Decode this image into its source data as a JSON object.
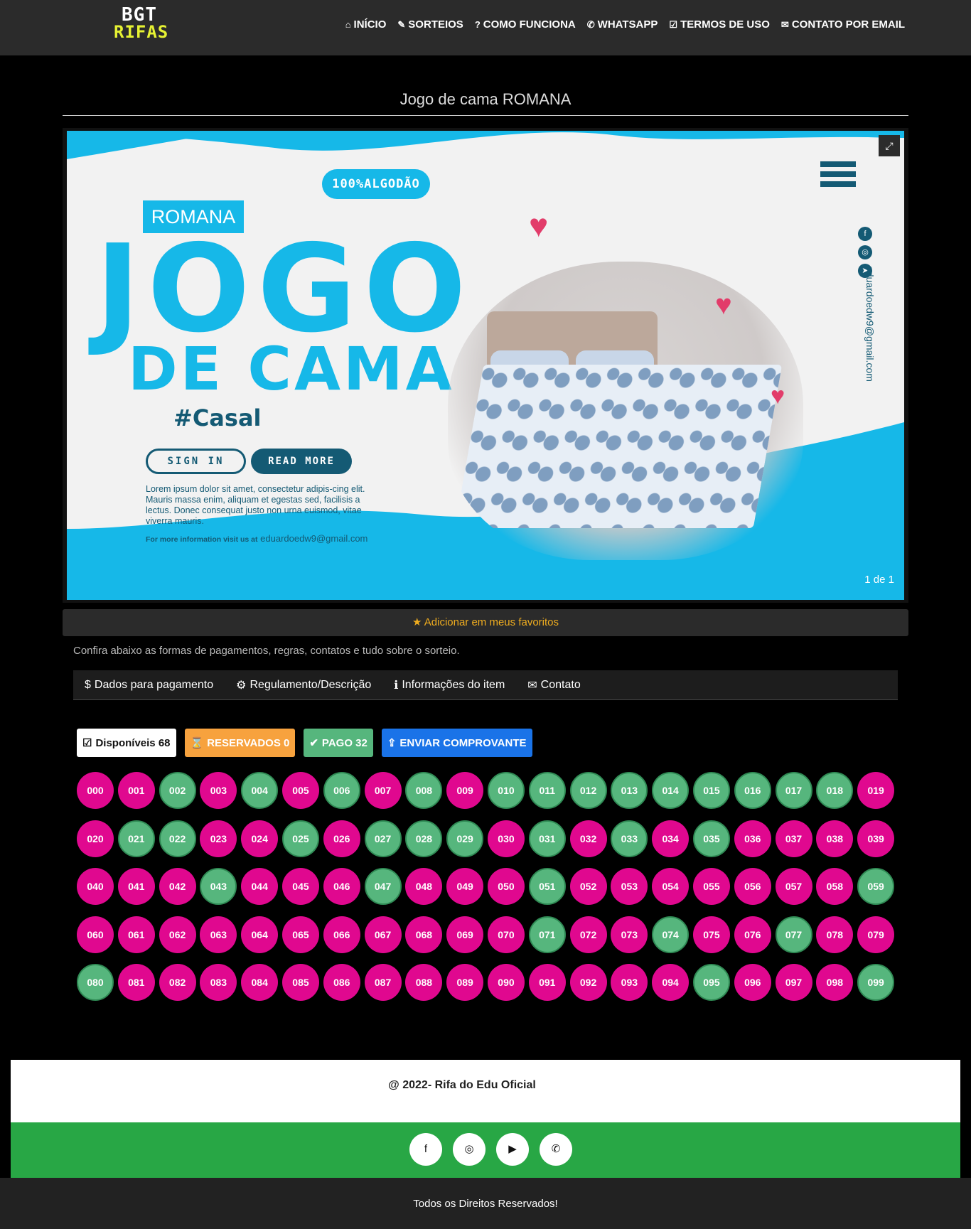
{
  "logo": {
    "line1": "BGT",
    "line2": "RIFAS"
  },
  "nav": [
    {
      "icon": "home-icon",
      "glyph": "⌂",
      "label": "INÍCIO"
    },
    {
      "icon": "ticket-icon",
      "glyph": "✎",
      "label": "SORTEIOS"
    },
    {
      "icon": "question-circle-icon",
      "glyph": "?",
      "label": "COMO FUNCIONA"
    },
    {
      "icon": "whatsapp-icon",
      "glyph": "✆",
      "label": "WHATSAPP"
    },
    {
      "icon": "check-square-icon",
      "glyph": "☑",
      "label": "TERMOS DE USO"
    },
    {
      "icon": "envelope-icon",
      "glyph": "✉",
      "label": "CONTATO POR EMAIL"
    }
  ],
  "page_title": "Jogo de cama ROMANA",
  "banner": {
    "algodao": "100%ALGODÃO",
    "romana": "ROMANA",
    "jogo": "JOGO",
    "de_cama": "DE CAMA",
    "casal": "#Casal",
    "sign_in": "SIGN IN",
    "read_more": "READ MORE",
    "lorem": "Lorem ipsum dolor sit amet, consectetur adipis-cing elit. Mauris massa enim, aliquam et egestas sed, facilisis a lectus. Donec consequat justo non urna euismod, vitae viverra mauris.",
    "more_info_prefix": "For more information visit us at",
    "more_info_email": "eduardoedw9@gmail.com",
    "side_email": "eduardoedw9@gmail.com",
    "counter": "1 de 1"
  },
  "favorite_label": "Adicionar em meus favoritos",
  "info_text": "Confira abaixo as formas de pagamentos, regras, contatos e tudo sobre o sorteio.",
  "tabs": [
    {
      "icon": "dollar-icon",
      "glyph": "$",
      "label": "Dados para pagamento"
    },
    {
      "icon": "gear-icon",
      "glyph": "⚙",
      "label": "Regulamento/Descrição"
    },
    {
      "icon": "info-icon",
      "glyph": "ℹ",
      "label": "Informações do item"
    },
    {
      "icon": "envelope-icon",
      "glyph": "✉",
      "label": "Contato"
    }
  ],
  "filters": {
    "disponiveis": "Disponíveis 68",
    "reservados": "RESERVADOS 0",
    "pago": "PAGO 32",
    "enviar": "ENVIAR COMPROVANTE"
  },
  "numbers": {
    "paid": [
      "002",
      "004",
      "006",
      "008",
      "010",
      "011",
      "012",
      "013",
      "014",
      "015",
      "016",
      "017",
      "018",
      "021",
      "022",
      "025",
      "027",
      "028",
      "029",
      "031",
      "033",
      "035",
      "043",
      "047",
      "051",
      "059",
      "071",
      "074",
      "077",
      "080",
      "095",
      "099"
    ]
  },
  "footer": {
    "copyright": "@ 2022- Rifa do Edu Oficial",
    "rights": "Todos os Direitos Reservados!"
  },
  "socials": [
    {
      "icon": "facebook-icon",
      "glyph": "f"
    },
    {
      "icon": "instagram-icon",
      "glyph": "◎"
    },
    {
      "icon": "youtube-icon",
      "glyph": "▶"
    },
    {
      "icon": "whatsapp-icon",
      "glyph": "✆"
    }
  ],
  "colors": {
    "available": "#e0088f",
    "paid": "#56b67d",
    "reserved": "#f7a23e",
    "send": "#1a73e8",
    "footer_green": "#28a745",
    "favorite": "#f0ad1f"
  }
}
